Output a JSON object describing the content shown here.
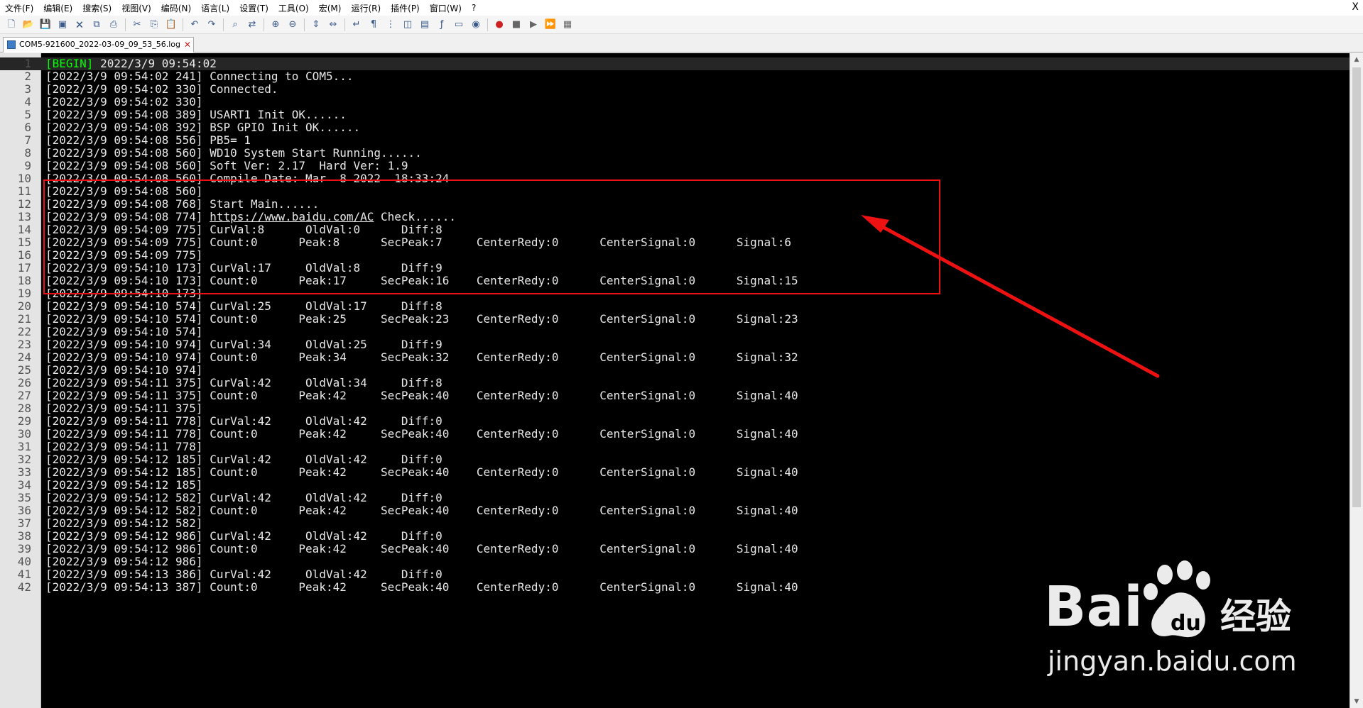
{
  "menu": {
    "items": [
      "文件(F)",
      "编辑(E)",
      "搜索(S)",
      "视图(V)",
      "编码(N)",
      "语言(L)",
      "设置(T)",
      "工具(O)",
      "宏(M)",
      "运行(R)",
      "插件(P)",
      "窗口(W)",
      "?"
    ],
    "close_glyph": "X"
  },
  "toolbar": {
    "icons": [
      "new-file-icon",
      "open-file-icon",
      "save-icon",
      "save-all-icon",
      "close-icon",
      "close-all-icon",
      "print-icon",
      "cut-icon",
      "copy-icon",
      "paste-icon",
      "undo-icon",
      "redo-icon",
      "find-icon",
      "replace-icon",
      "zoom-in-icon",
      "zoom-out-icon",
      "sync-vertical-icon",
      "sync-horizontal-icon",
      "word-wrap-icon",
      "show-all-chars-icon",
      "indent-guide-icon",
      "language-icon",
      "doc-map-icon",
      "function-list-icon",
      "folder-workspace-icon",
      "monitoring-icon",
      "record-macro-icon",
      "stop-record-icon",
      "play-macro-icon",
      "run-macro-multiple-icon",
      "save-macro-icon"
    ]
  },
  "tab": {
    "filename": "COM5-921600_2022-03-09_09_53_56.log",
    "close_glyph": "✕"
  },
  "lines": [
    {
      "n": "1",
      "parts": [
        {
          "t": "[BEGIN]",
          "c": "kw"
        },
        {
          "t": " 2022/3/9 09:54:02"
        }
      ]
    },
    {
      "n": "2",
      "parts": [
        {
          "t": "[2022/3/9 09:54:02 241] Connecting to COM5..."
        }
      ]
    },
    {
      "n": "3",
      "parts": [
        {
          "t": "[2022/3/9 09:54:02 330] Connected."
        }
      ]
    },
    {
      "n": "4",
      "parts": [
        {
          "t": "[2022/3/9 09:54:02 330]"
        }
      ]
    },
    {
      "n": "5",
      "parts": [
        {
          "t": "[2022/3/9 09:54:08 389] USART1 Init OK......"
        }
      ]
    },
    {
      "n": "6",
      "parts": [
        {
          "t": "[2022/3/9 09:54:08 392] BSP GPIO Init OK......"
        }
      ]
    },
    {
      "n": "7",
      "parts": [
        {
          "t": "[2022/3/9 09:54:08 556] PB5= 1"
        }
      ]
    },
    {
      "n": "8",
      "parts": [
        {
          "t": "[2022/3/9 09:54:08 560] WD10 System Start Running......"
        }
      ]
    },
    {
      "n": "9",
      "parts": [
        {
          "t": "[2022/3/9 09:54:08 560] Soft Ver: 2.17  Hard Ver: 1.9"
        }
      ]
    },
    {
      "n": "10",
      "parts": [
        {
          "t": "[2022/3/9 09:54:08 560] Compile Date: Mar  8 2022  18:33:24"
        }
      ]
    },
    {
      "n": "11",
      "parts": [
        {
          "t": "[2022/3/9 09:54:08 560]"
        }
      ]
    },
    {
      "n": "12",
      "parts": [
        {
          "t": "[2022/3/9 09:54:08 768] Start Main......"
        }
      ]
    },
    {
      "n": "13",
      "parts": [
        {
          "t": "[2022/3/9 09:54:08 774] "
        },
        {
          "t": "https://www.baidu.com/AC",
          "c": "url"
        },
        {
          "t": " Check......"
        }
      ]
    },
    {
      "n": "14",
      "parts": [
        {
          "t": "[2022/3/9 09:54:09 775] CurVal:8      OldVal:0      Diff:8"
        }
      ]
    },
    {
      "n": "15",
      "parts": [
        {
          "t": "[2022/3/9 09:54:09 775] Count:0      Peak:8      SecPeak:7     CenterRedy:0      CenterSignal:0      Signal:6"
        }
      ]
    },
    {
      "n": "16",
      "parts": [
        {
          "t": "[2022/3/9 09:54:09 775]"
        }
      ]
    },
    {
      "n": "17",
      "parts": [
        {
          "t": "[2022/3/9 09:54:10 173] CurVal:17     OldVal:8      Diff:9"
        }
      ]
    },
    {
      "n": "18",
      "parts": [
        {
          "t": "[2022/3/9 09:54:10 173] Count:0      Peak:17     SecPeak:16    CenterRedy:0      CenterSignal:0      Signal:15"
        }
      ]
    },
    {
      "n": "19",
      "parts": [
        {
          "t": "[2022/3/9 09:54:10 173]"
        }
      ]
    },
    {
      "n": "20",
      "parts": [
        {
          "t": "[2022/3/9 09:54:10 574] CurVal:25     OldVal:17     Diff:8"
        }
      ]
    },
    {
      "n": "21",
      "parts": [
        {
          "t": "[2022/3/9 09:54:10 574] Count:0      Peak:25     SecPeak:23    CenterRedy:0      CenterSignal:0      Signal:23"
        }
      ]
    },
    {
      "n": "22",
      "parts": [
        {
          "t": "[2022/3/9 09:54:10 574]"
        }
      ]
    },
    {
      "n": "23",
      "parts": [
        {
          "t": "[2022/3/9 09:54:10 974] CurVal:34     OldVal:25     Diff:9"
        }
      ]
    },
    {
      "n": "24",
      "parts": [
        {
          "t": "[2022/3/9 09:54:10 974] Count:0      Peak:34     SecPeak:32    CenterRedy:0      CenterSignal:0      Signal:32"
        }
      ]
    },
    {
      "n": "25",
      "parts": [
        {
          "t": "[2022/3/9 09:54:10 974]"
        }
      ]
    },
    {
      "n": "26",
      "parts": [
        {
          "t": "[2022/3/9 09:54:11 375] CurVal:42     OldVal:34     Diff:8"
        }
      ]
    },
    {
      "n": "27",
      "parts": [
        {
          "t": "[2022/3/9 09:54:11 375] Count:0      Peak:42     SecPeak:40    CenterRedy:0      CenterSignal:0      Signal:40"
        }
      ]
    },
    {
      "n": "28",
      "parts": [
        {
          "t": "[2022/3/9 09:54:11 375]"
        }
      ]
    },
    {
      "n": "29",
      "parts": [
        {
          "t": "[2022/3/9 09:54:11 778] CurVal:42     OldVal:42     Diff:0"
        }
      ]
    },
    {
      "n": "30",
      "parts": [
        {
          "t": "[2022/3/9 09:54:11 778] Count:0      Peak:42     SecPeak:40    CenterRedy:0      CenterSignal:0      Signal:40"
        }
      ]
    },
    {
      "n": "31",
      "parts": [
        {
          "t": "[2022/3/9 09:54:11 778]"
        }
      ]
    },
    {
      "n": "32",
      "parts": [
        {
          "t": "[2022/3/9 09:54:12 185] CurVal:42     OldVal:42     Diff:0"
        }
      ]
    },
    {
      "n": "33",
      "parts": [
        {
          "t": "[2022/3/9 09:54:12 185] Count:0      Peak:42     SecPeak:40    CenterRedy:0      CenterSignal:0      Signal:40"
        }
      ]
    },
    {
      "n": "34",
      "parts": [
        {
          "t": "[2022/3/9 09:54:12 185]"
        }
      ]
    },
    {
      "n": "35",
      "parts": [
        {
          "t": "[2022/3/9 09:54:12 582] CurVal:42     OldVal:42     Diff:0"
        }
      ]
    },
    {
      "n": "36",
      "parts": [
        {
          "t": "[2022/3/9 09:54:12 582] Count:0      Peak:42     SecPeak:40    CenterRedy:0      CenterSignal:0      Signal:40"
        }
      ]
    },
    {
      "n": "37",
      "parts": [
        {
          "t": "[2022/3/9 09:54:12 582]"
        }
      ]
    },
    {
      "n": "38",
      "parts": [
        {
          "t": "[2022/3/9 09:54:12 986] CurVal:42     OldVal:42     Diff:0"
        }
      ]
    },
    {
      "n": "39",
      "parts": [
        {
          "t": "[2022/3/9 09:54:12 986] Count:0      Peak:42     SecPeak:40    CenterRedy:0      CenterSignal:0      Signal:40"
        }
      ]
    },
    {
      "n": "40",
      "parts": [
        {
          "t": "[2022/3/9 09:54:12 986]"
        }
      ]
    },
    {
      "n": "41",
      "parts": [
        {
          "t": "[2022/3/9 09:54:13 386] CurVal:42     OldVal:42     Diff:0"
        }
      ]
    },
    {
      "n": "42",
      "parts": [
        {
          "t": "[2022/3/9 09:54:13 387] Count:0      Peak:42     SecPeak:40    CenterRedy:0      CenterSignal:0      Signal:40"
        }
      ]
    }
  ],
  "watermark": {
    "logo_text": "Bai du 经验",
    "subtitle": "jingyan.baidu.com"
  },
  "colors": {
    "editor_bg": "#000000",
    "text": "#e8e8e8",
    "begin_tag": "#00ff00",
    "annotation": "#ee1111"
  }
}
